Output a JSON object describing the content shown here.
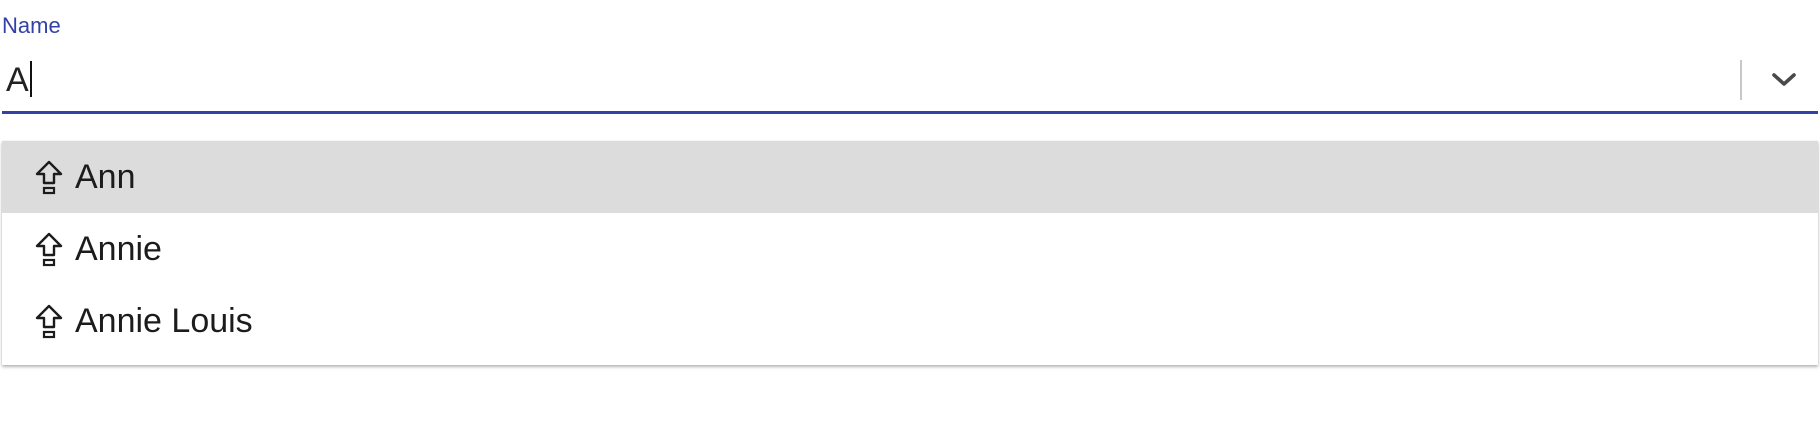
{
  "field": {
    "label": "Name",
    "value": "A",
    "toggle_icon": "chevron-down-icon"
  },
  "colors": {
    "accent": "#3241a8",
    "highlight": "#dcdcdc",
    "text": "#1c1c1c"
  },
  "options": [
    {
      "label": "Ann",
      "icon": "upload-arrow-icon",
      "highlighted": true
    },
    {
      "label": "Annie",
      "icon": "upload-arrow-icon",
      "highlighted": false
    },
    {
      "label": "Annie Louis",
      "icon": "upload-arrow-icon",
      "highlighted": false
    }
  ]
}
